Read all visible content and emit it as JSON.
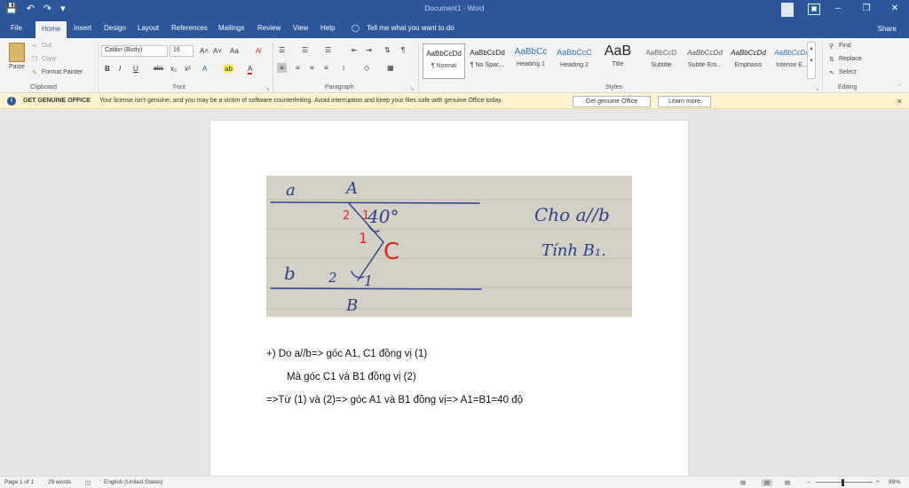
{
  "titlebar": {
    "title": "Document1  -  Word",
    "save_icon": "💾",
    "undo_icon": "↶",
    "redo_icon": "↷",
    "customize_icon": "▾",
    "minimize": "–",
    "restore": "❐",
    "close": "✕",
    "ribbon_options_icon": "▣"
  },
  "tabs": {
    "file": "File",
    "home": "Home",
    "insert": "Insert",
    "design": "Design",
    "layout": "Layout",
    "references": "References",
    "mailings": "Mailings",
    "review": "Review",
    "view": "View",
    "help": "Help",
    "tellme": "Tell me what you want to do",
    "share": "Share"
  },
  "clipboard": {
    "paste": "Paste",
    "cut": "Cut",
    "copy": "Copy",
    "format_painter": "Format Painter",
    "label": "Clipboard"
  },
  "font": {
    "name": "Calibri (Body)",
    "size": "16",
    "grow": "A˄",
    "shrink": "A˅",
    "case": "Aa",
    "clear": "A̸",
    "bold": "B",
    "italic": "I",
    "underline": "U",
    "strike": "abc",
    "sub": "x₂",
    "sup": "x²",
    "effects": "A",
    "highlight": "ab",
    "color": "A",
    "label": "Font"
  },
  "paragraph": {
    "label": "Paragraph",
    "bullets": "☰",
    "numbering": "☰",
    "multilevel": "☰",
    "decrease_indent": "⇤",
    "increase_indent": "⇥",
    "sort": "⇅",
    "pilcrow": "¶",
    "align_left": "≡",
    "center": "≡",
    "align_right": "≡",
    "justify": "≡",
    "line_spacing": "↕",
    "shading": "◇",
    "borders": "▦"
  },
  "styles": {
    "label": "Styles",
    "items": [
      {
        "preview": "AaBbCcDd",
        "name": "¶ Normal"
      },
      {
        "preview": "AaBbCcDd",
        "name": "¶ No Spac..."
      },
      {
        "preview": "AaBbCc",
        "name": "Heading 1"
      },
      {
        "preview": "AaBbCcC",
        "name": "Heading 2"
      },
      {
        "preview": "AaB",
        "name": "Title"
      },
      {
        "preview": "AaBbCcD",
        "name": "Subtitle"
      },
      {
        "preview": "AaBbCcDd",
        "name": "Subtle Em..."
      },
      {
        "preview": "AaBbCcDd",
        "name": "Emphasis"
      },
      {
        "preview": "AaBbCcDd",
        "name": "Intense E..."
      }
    ]
  },
  "editing": {
    "find": "Find",
    "replace": "Replace",
    "select": "Select",
    "label": "Editing"
  },
  "message_bar": {
    "title": "GET GENUINE OFFICE",
    "text": "Your license isn't genuine, and you may be a victim of software counterfeiting. Avoid interruption and keep your files safe with genuine Office today.",
    "primary_button": "Get genuine Office",
    "secondary_button": "Learn more",
    "close": "×"
  },
  "photo": {
    "label_a_left": "a",
    "label_A": "A",
    "label_2_top": "2",
    "label_1_top": "1",
    "label_40_degrees": "40°",
    "label_1_red": "1",
    "label_C": "C",
    "label_b_left": "b",
    "label_2_bottom": "2",
    "label_1_bottom": "1",
    "label_B": "B",
    "note_given": "Cho a//b",
    "note_find": "Tính B₁."
  },
  "document": {
    "line1": "+) Do a//b=> góc A1, C1 đồng vị  (1)",
    "line2": "Mà góc C1 và B1 đồng vị   (2)",
    "line3": "=>Từ (1) và (2)=> góc A1 và B1 đồng vị=> A1=B1=40 độ"
  },
  "status": {
    "page": "Page 1 of 1",
    "words": "29 words",
    "language": "English (United States)",
    "zoom": "99%",
    "zoom_minus": "–",
    "zoom_plus": "+"
  },
  "colors": {
    "brand_blue": "#2b579a",
    "message_bar": "#fff4ce",
    "ink_blue": "#2a3f8f",
    "ink_red": "#e0241e"
  }
}
